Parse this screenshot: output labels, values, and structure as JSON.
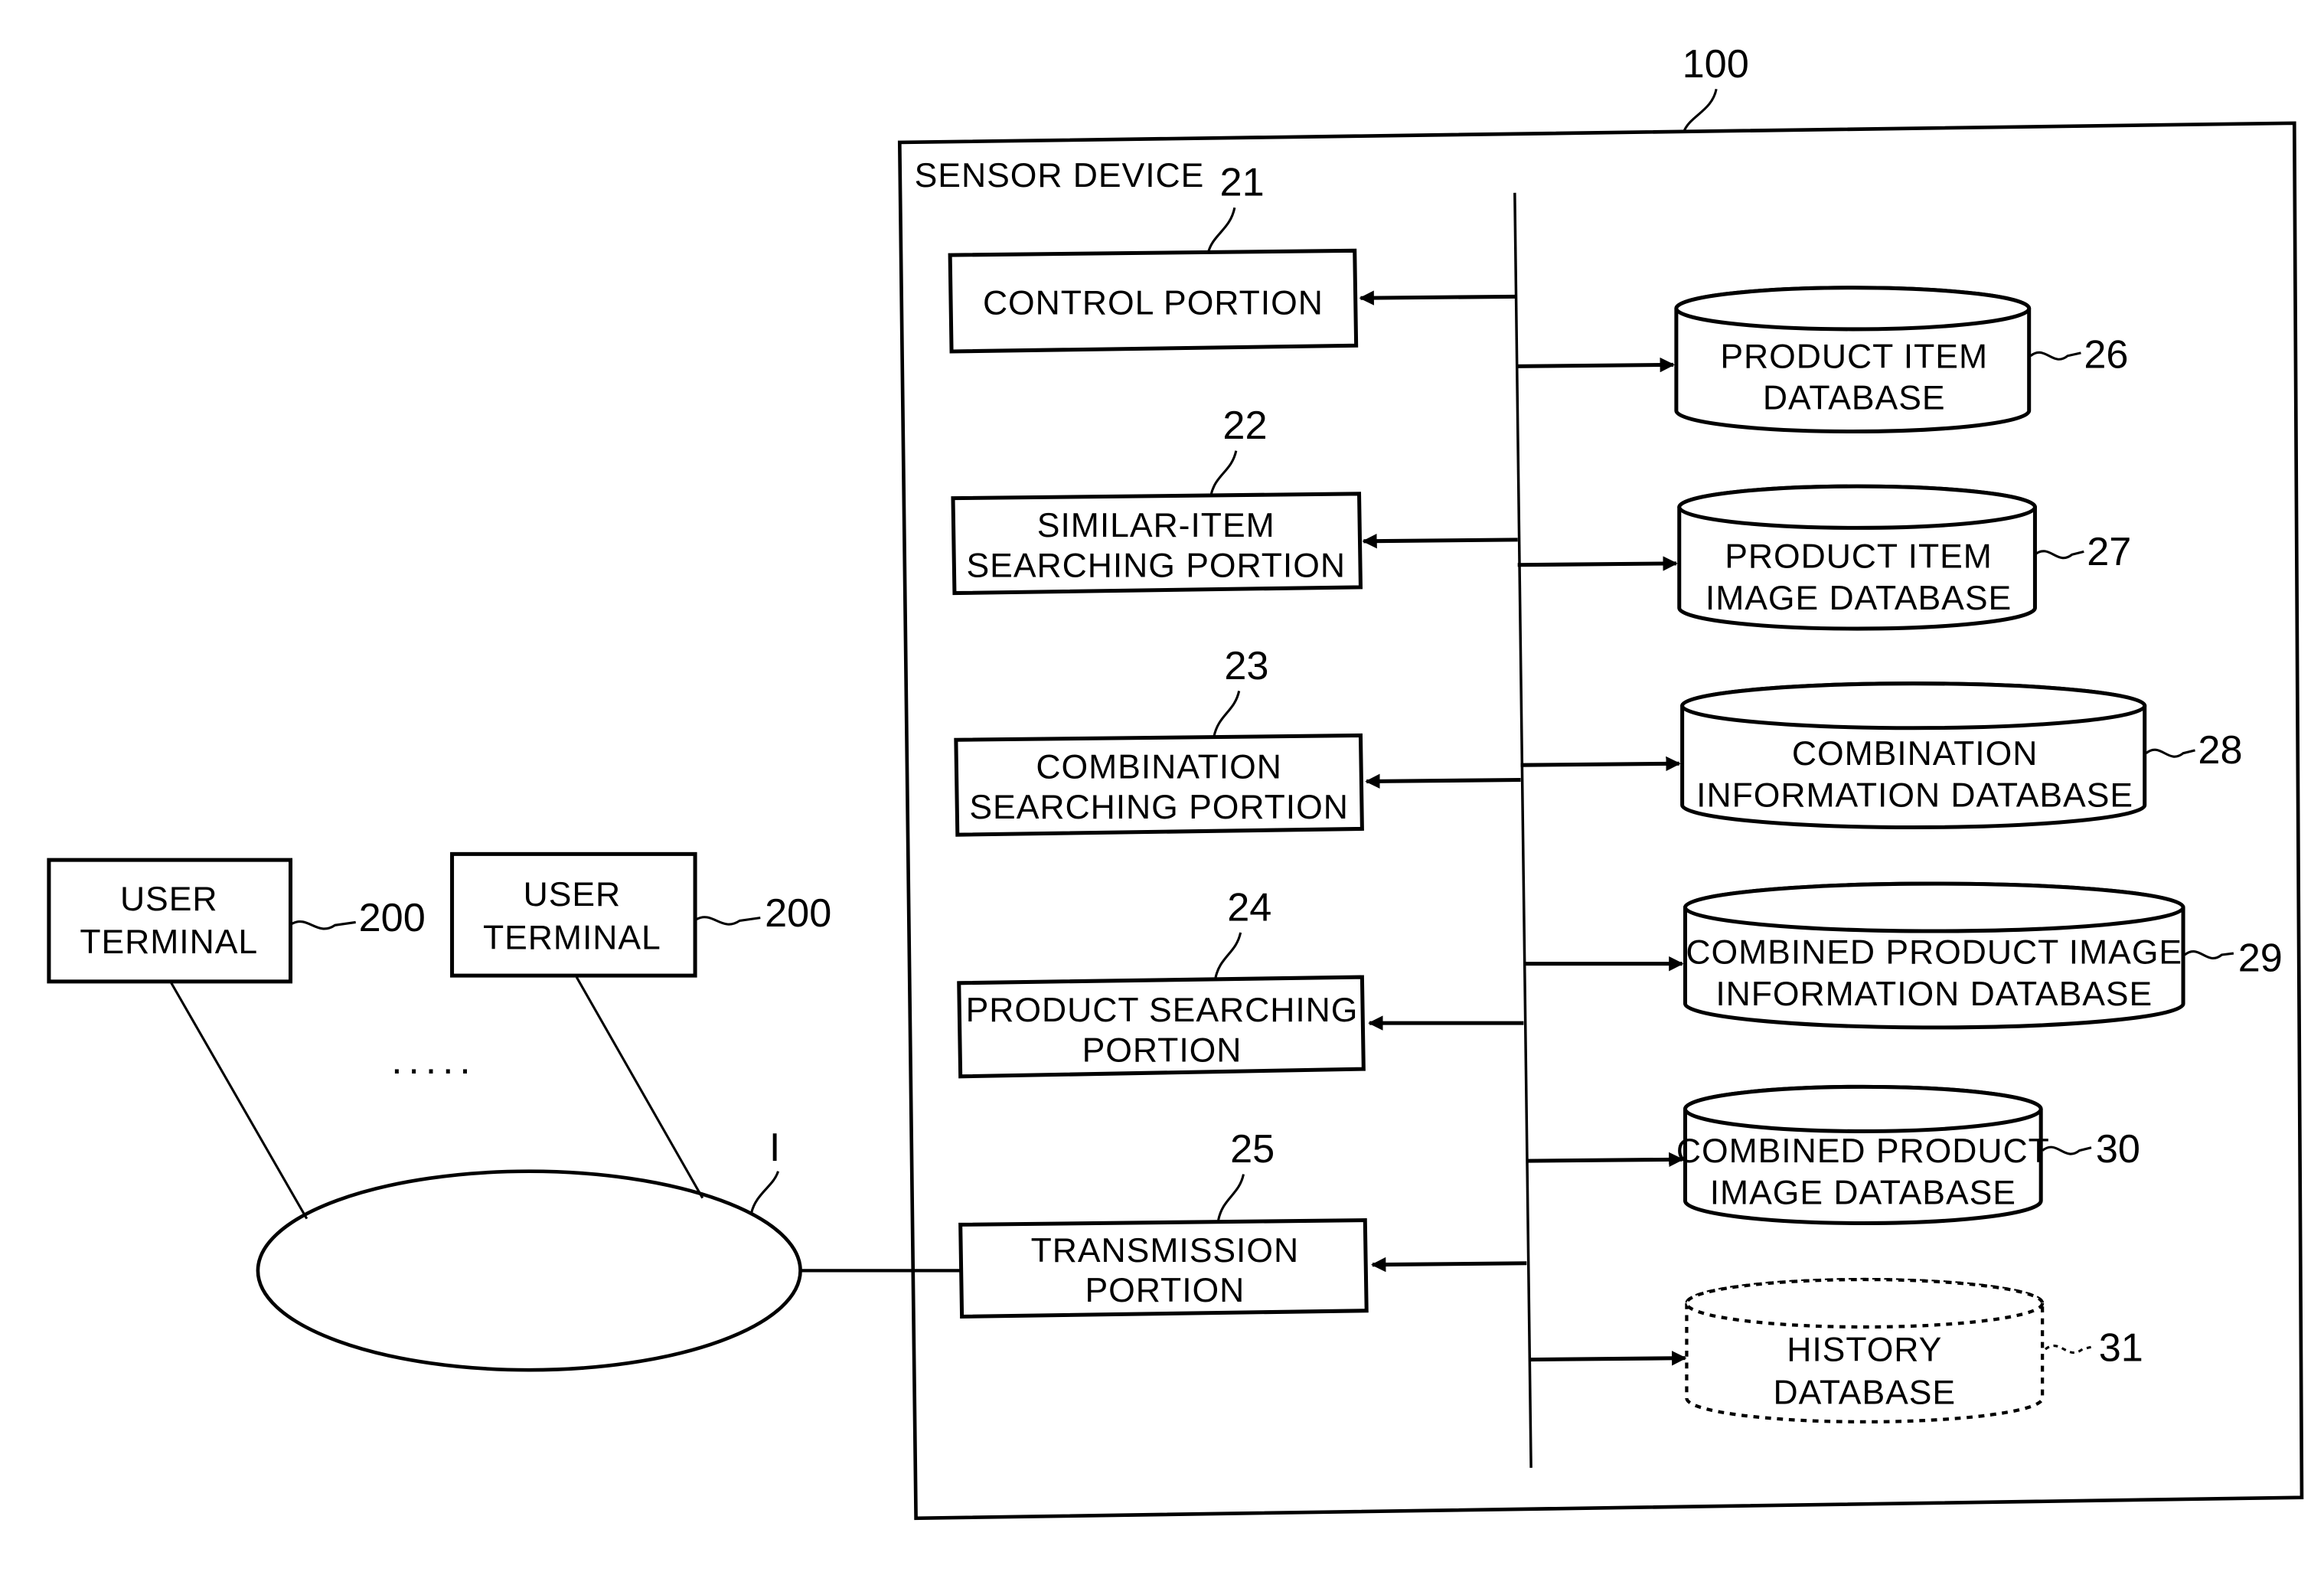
{
  "diagram": {
    "system_ref": "100",
    "system_title": "SENSOR DEVICE",
    "network_ref": "I",
    "ellipsis": ".....",
    "portions": [
      {
        "ref": "21",
        "lines": [
          "CONTROL PORTION"
        ]
      },
      {
        "ref": "22",
        "lines": [
          "SIMILAR-ITEM",
          "SEARCHING PORTION"
        ]
      },
      {
        "ref": "23",
        "lines": [
          "COMBINATION",
          "SEARCHING PORTION"
        ]
      },
      {
        "ref": "24",
        "lines": [
          "PRODUCT SEARCHING",
          "PORTION"
        ]
      },
      {
        "ref": "25",
        "lines": [
          "TRANSMISSION",
          "PORTION"
        ]
      }
    ],
    "databases": [
      {
        "ref": "26",
        "lines": [
          "PRODUCT ITEM",
          "DATABASE"
        ],
        "style": "solid"
      },
      {
        "ref": "27",
        "lines": [
          "PRODUCT ITEM",
          "IMAGE DATABASE"
        ],
        "style": "solid"
      },
      {
        "ref": "28",
        "lines": [
          "COMBINATION",
          "INFORMATION DATABASE"
        ],
        "style": "solid"
      },
      {
        "ref": "29",
        "lines": [
          "COMBINED PRODUCT IMAGE",
          "INFORMATION DATABASE"
        ],
        "style": "solid"
      },
      {
        "ref": "30",
        "lines": [
          "COMBINED PRODUCT",
          "IMAGE DATABASE"
        ],
        "style": "solid"
      },
      {
        "ref": "31",
        "lines": [
          "HISTORY",
          "DATABASE"
        ],
        "style": "dashed"
      }
    ],
    "user_terminals": [
      {
        "ref": "200",
        "lines": [
          "USER",
          "TERMINAL"
        ]
      },
      {
        "ref": "200",
        "lines": [
          "USER",
          "TERMINAL"
        ]
      }
    ]
  }
}
